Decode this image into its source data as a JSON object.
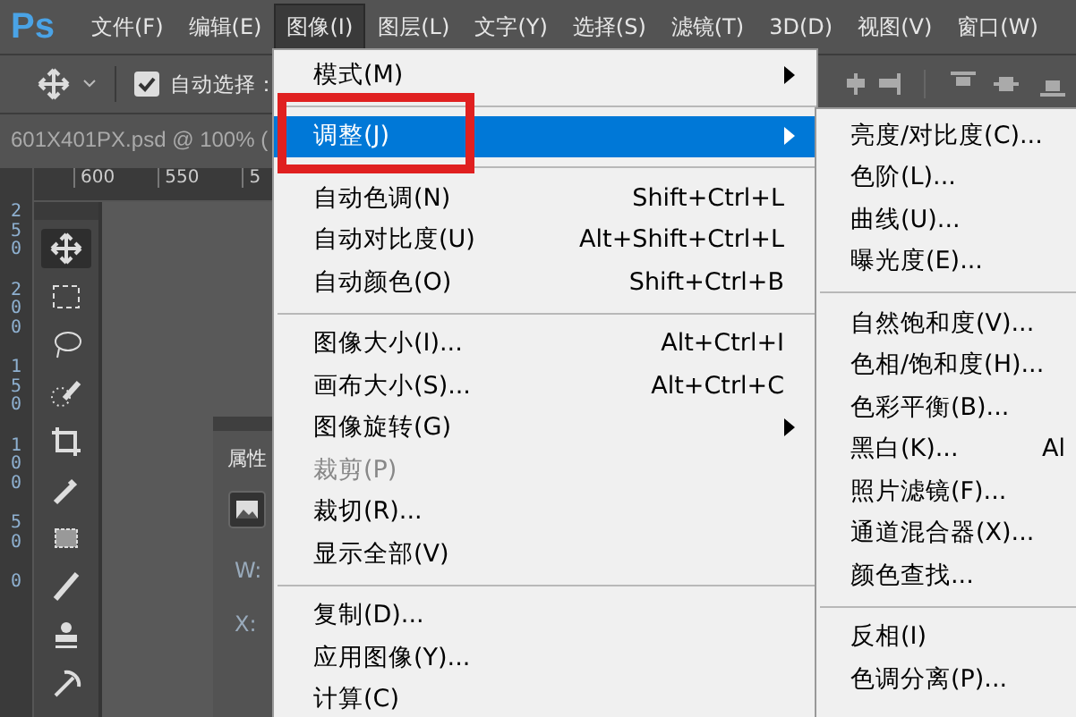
{
  "app_logo": "Ps",
  "menu_bar": [
    {
      "label": "文件(F)",
      "selected": false
    },
    {
      "label": "编辑(E)",
      "selected": false
    },
    {
      "label": "图像(I)",
      "selected": true
    },
    {
      "label": "图层(L)",
      "selected": false
    },
    {
      "label": "文字(Y)",
      "selected": false
    },
    {
      "label": "选择(S)",
      "selected": false
    },
    {
      "label": "滤镜(T)",
      "selected": false
    },
    {
      "label": "3D(D)",
      "selected": false
    },
    {
      "label": "视图(V)",
      "selected": false
    },
    {
      "label": "窗口(W)",
      "selected": false
    }
  ],
  "options_bar": {
    "auto_select_checked": true,
    "auto_select_label": "自动选择："
  },
  "document_tab": "601X401PX.psd @ 100% (",
  "horizontal_ruler": [
    "600",
    "550",
    "5"
  ],
  "vertical_ruler": [
    "250",
    "200",
    "150",
    "100",
    "50",
    "0"
  ],
  "properties_panel": {
    "title": "属性",
    "labels": [
      "W:",
      "X:"
    ]
  },
  "image_menu": [
    {
      "kind": "item",
      "label": "模式(M)",
      "submenu": true,
      "selected": false
    },
    {
      "kind": "separator"
    },
    {
      "kind": "item",
      "label": "调整(J)",
      "submenu": true,
      "selected": true
    },
    {
      "kind": "separator"
    },
    {
      "kind": "item",
      "label": "自动色调(N)",
      "shortcut": "Shift+Ctrl+L",
      "selected": false
    },
    {
      "kind": "item",
      "label": "自动对比度(U)",
      "shortcut": "Alt+Shift+Ctrl+L",
      "selected": false
    },
    {
      "kind": "item",
      "label": "自动颜色(O)",
      "shortcut": "Shift+Ctrl+B",
      "selected": false
    },
    {
      "kind": "separator"
    },
    {
      "kind": "item",
      "label": "图像大小(I)...",
      "shortcut": "Alt+Ctrl+I",
      "selected": false
    },
    {
      "kind": "item",
      "label": "画布大小(S)...",
      "shortcut": "Alt+Ctrl+C",
      "selected": false
    },
    {
      "kind": "item",
      "label": "图像旋转(G)",
      "submenu": true,
      "selected": false
    },
    {
      "kind": "item",
      "label": "裁剪(P)",
      "disabled": true,
      "selected": false
    },
    {
      "kind": "item",
      "label": "裁切(R)...",
      "selected": false
    },
    {
      "kind": "item",
      "label": "显示全部(V)",
      "selected": false
    },
    {
      "kind": "separator"
    },
    {
      "kind": "item",
      "label": "复制(D)...",
      "selected": false
    },
    {
      "kind": "item",
      "label": "应用图像(Y)...",
      "selected": false
    },
    {
      "kind": "item",
      "label": "计算(C)",
      "selected": false
    }
  ],
  "adjust_submenu": [
    {
      "kind": "item",
      "label": "亮度/对比度(C)..."
    },
    {
      "kind": "item",
      "label": "色阶(L)..."
    },
    {
      "kind": "item",
      "label": "曲线(U)..."
    },
    {
      "kind": "item",
      "label": "曝光度(E)..."
    },
    {
      "kind": "separator"
    },
    {
      "kind": "item",
      "label": "自然饱和度(V)..."
    },
    {
      "kind": "item",
      "label": "色相/饱和度(H)..."
    },
    {
      "kind": "item",
      "label": "色彩平衡(B)..."
    },
    {
      "kind": "item",
      "label": "黑白(K)...",
      "shortcut": "Al"
    },
    {
      "kind": "item",
      "label": "照片滤镜(F)..."
    },
    {
      "kind": "item",
      "label": "通道混合器(X)..."
    },
    {
      "kind": "item",
      "label": "颜色查找..."
    },
    {
      "kind": "separator"
    },
    {
      "kind": "item",
      "label": "反相(I)"
    },
    {
      "kind": "item",
      "label": "色调分离(P)..."
    }
  ]
}
